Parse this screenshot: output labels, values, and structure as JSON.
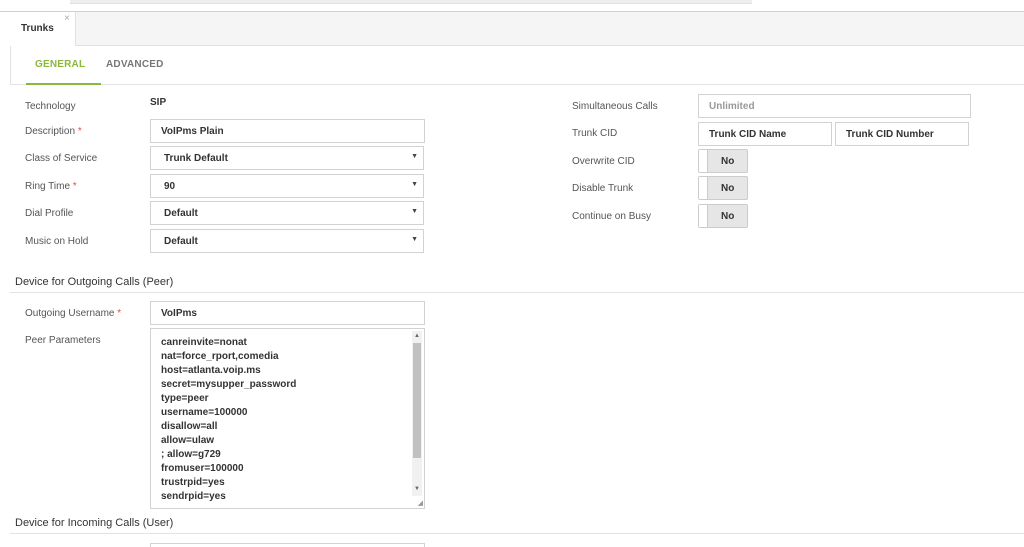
{
  "window_tab": {
    "label": "Trunks",
    "close_glyph": "×"
  },
  "section_tabs": [
    {
      "label": "GENERAL",
      "active": true
    },
    {
      "label": "ADVANCED",
      "active": false
    }
  ],
  "colors": {
    "accent": "#8bb83c",
    "required": "#d9534f"
  },
  "general": {
    "technology": {
      "label": "Technology",
      "value": "SIP"
    },
    "description": {
      "label": "Description",
      "required_mark": "*",
      "value": "VoIPms Plain"
    },
    "class_of_service": {
      "label": "Class of Service",
      "value": "Trunk Default"
    },
    "ring_time": {
      "label": "Ring Time",
      "required_mark": "*",
      "value": "90"
    },
    "dial_profile": {
      "label": "Dial Profile",
      "value": "Default"
    },
    "music_on_hold": {
      "label": "Music on Hold",
      "value": "Default"
    },
    "simultaneous_calls": {
      "label": "Simultaneous Calls",
      "placeholder": "Unlimited"
    },
    "trunk_cid": {
      "label": "Trunk CID",
      "name_value": "Trunk CID Name",
      "number_value": "Trunk CID Number"
    },
    "overwrite_cid": {
      "label": "Overwrite CID",
      "value": "No"
    },
    "disable_trunk": {
      "label": "Disable Trunk",
      "value": "No"
    },
    "continue_on_busy": {
      "label": "Continue on Busy",
      "value": "No"
    }
  },
  "outgoing": {
    "heading": "Device for Outgoing Calls (Peer)",
    "username": {
      "label": "Outgoing Username",
      "required_mark": "*",
      "value": "VoIPms"
    },
    "peer_parameters": {
      "label": "Peer Parameters",
      "value": "canreinvite=nonat\nnat=force_rport,comedia\nhost=atlanta.voip.ms\nsecret=mysupper_password\ntype=peer\nusername=100000\ndisallow=all\nallow=ulaw\n; allow=g729\nfromuser=100000\ntrustrpid=yes\nsendrpid=yes"
    }
  },
  "incoming": {
    "heading": "Device for Incoming Calls (User)"
  },
  "icons": {
    "caret": "▼",
    "scroll_up": "▲",
    "scroll_down": "▼",
    "resize_grip": "◢"
  }
}
